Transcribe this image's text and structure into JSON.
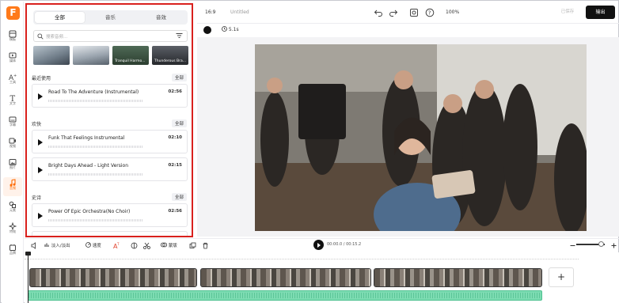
{
  "app": {
    "logo": "F",
    "ratio": "16:9",
    "title": "Untitled",
    "zoom": "100%",
    "save_label": "已保存",
    "export_label": "输出"
  },
  "rail": [
    {
      "label": "模板",
      "icon": "template-icon"
    },
    {
      "label": "媒体",
      "icon": "media-icon"
    },
    {
      "label": "工具",
      "icon": "tools-icon"
    },
    {
      "label": "文字",
      "icon": "text-icon"
    },
    {
      "label": "字幕",
      "icon": "subtitle-icon"
    },
    {
      "label": "视频",
      "icon": "video-icon"
    },
    {
      "label": "图片",
      "icon": "image-icon"
    },
    {
      "label": "音频",
      "icon": "audio-icon"
    },
    {
      "label": "元素",
      "icon": "elements-icon"
    },
    {
      "label": "特效",
      "icon": "effects-icon"
    },
    {
      "label": "品牌",
      "icon": "brand-icon"
    }
  ],
  "panel": {
    "tabs": [
      "全部",
      "音乐",
      "音效"
    ],
    "search_placeholder": "搜索音频...",
    "thumbs": [
      "",
      "",
      "Tranquil Harmo...",
      "Thunderous Bra..."
    ],
    "sections": [
      {
        "title": "最近使用",
        "all": "全部",
        "tracks": [
          {
            "name": "Road To The Adventure (Instrumental)",
            "duration": "02:56"
          }
        ]
      },
      {
        "title": "欢快",
        "all": "全部",
        "tracks": [
          {
            "name": "Funk That Feelings Instrumental",
            "duration": "02:10"
          },
          {
            "name": "Bright Days Ahead - Light Version",
            "duration": "02:15"
          }
        ]
      },
      {
        "title": "史诗",
        "all": "全部",
        "tracks": [
          {
            "name": "Power Of Epic Orchestra(No Choir)",
            "duration": "02:56"
          }
        ]
      }
    ]
  },
  "canvas": {
    "duration_chip": "5.1s"
  },
  "timeline": {
    "tools": [
      "淡入/淡出",
      "速度",
      "",
      "",
      "",
      "蒙版",
      "",
      ""
    ],
    "time_current": "00:00.0",
    "time_total": "00:15.2"
  },
  "colors": {
    "accent": "#ff6a00",
    "highlight": "#d9201d",
    "audio": "#7ddcb2"
  }
}
